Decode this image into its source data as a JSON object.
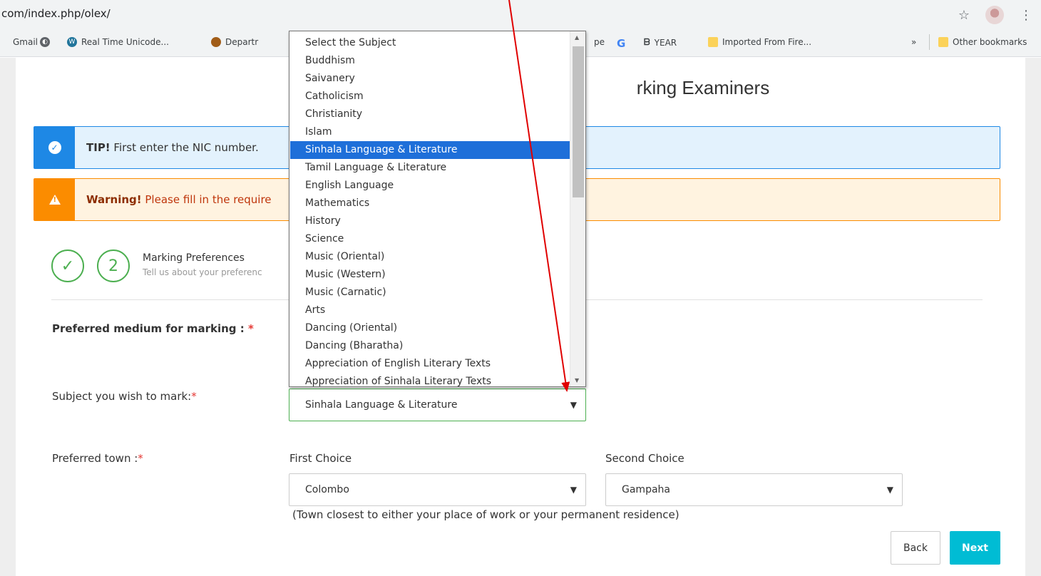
{
  "browser": {
    "url": "com/index.php/olex/",
    "bookmarks": [
      {
        "label": "Gmail",
        "icon": "gmail-icon"
      },
      {
        "label": "",
        "icon": "globe-icon"
      },
      {
        "label": "Real Time Unicode...",
        "icon": "wordpress-icon"
      },
      {
        "label": "Departr",
        "icon": "crest-icon"
      },
      {
        "label": "pe",
        "icon": ""
      },
      {
        "label": "G",
        "icon": "google-icon"
      },
      {
        "label": "YEAR",
        "icon": "year-icon"
      },
      {
        "label": "Imported From Fire...",
        "icon": "folder-icon"
      }
    ],
    "more": "»",
    "other_bookmarks": "Other bookmarks"
  },
  "page": {
    "title": "rking Examiners",
    "tip": {
      "strong": "TIP!",
      "text": " First enter the NIC number."
    },
    "warning": {
      "strong": "Warning!",
      "text": " Please fill in the require"
    },
    "steps": [
      "✓",
      "2"
    ],
    "step_title": "Marking Preferences",
    "step_sub": "Tell us about your preferenc",
    "medium_label": "Preferred medium for marking : ",
    "subject_label": "Subject you wish to mark:",
    "town_label": "Preferred town :",
    "required_mark": "*",
    "subject_select": {
      "value": "Sinhala Language & Literature"
    },
    "first_choice": {
      "label": "First Choice",
      "value": "Colombo"
    },
    "second_choice": {
      "label": "Second Choice",
      "value": "Gampaha"
    },
    "town_note": "(Town closest to either your place of work or your permanent residence)",
    "back_label": "Back",
    "next_label": "Next"
  },
  "dropdown": {
    "options": [
      "Select the Subject",
      "Buddhism",
      "Saivanery",
      "Catholicism",
      "Christianity",
      "Islam",
      "Sinhala Language & Literature",
      "Tamil Language & Literature",
      "English Language",
      "Mathematics",
      "History",
      "Science",
      "Music (Oriental)",
      "Music (Western)",
      "Music (Carnatic)",
      "Arts",
      "Dancing (Oriental)",
      "Dancing (Bharatha)",
      "Appreciation of English Literary Texts",
      "Appreciation of Sinhala Literary Texts"
    ],
    "selected_index": 6
  },
  "colors": {
    "info": "#1e88e5",
    "warning": "#fb8c00",
    "success": "#4caf50",
    "primary": "#00bcd4",
    "annotation_arrow": "#e00000"
  }
}
